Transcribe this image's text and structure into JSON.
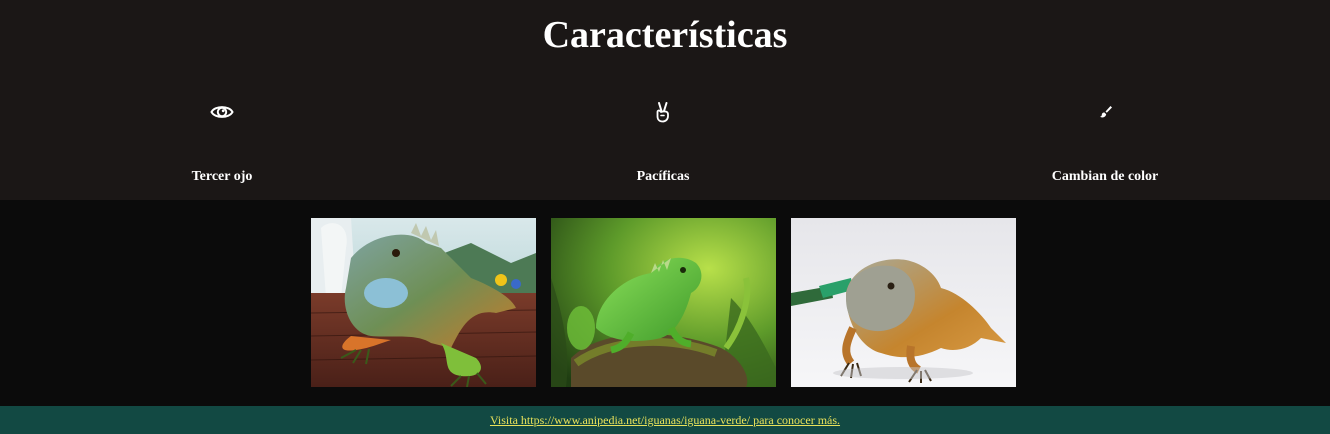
{
  "section": {
    "title": "Características"
  },
  "features": [
    {
      "label": "Tercer ojo",
      "icon": "eye-icon"
    },
    {
      "label": "Pacíficas",
      "icon": "peace-hand-icon"
    },
    {
      "label": "Cambian de color",
      "icon": "paintbrush-icon"
    }
  ],
  "gallery": {
    "images": [
      {
        "subject": "iguana-on-wooden-deck",
        "dominant_color": "#5c8a6a"
      },
      {
        "subject": "green-iguana-on-mossy-log",
        "dominant_color": "#6fbf3a"
      },
      {
        "subject": "grey-orange-iguana-white-background",
        "dominant_color": "#c98a4a"
      }
    ]
  },
  "footer": {
    "link_text": "Visita https://www.anipedia.net/iguanas/iguana-verde/ para conocer más.",
    "link_color": "#e9e25a",
    "background": "#124943"
  }
}
